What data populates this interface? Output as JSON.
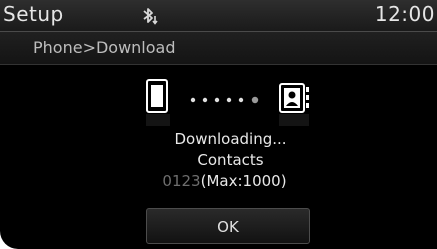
{
  "header": {
    "title": "Setup",
    "bluetooth_icon": "bluetooth-download-icon",
    "time": "12:00"
  },
  "breadcrumb": {
    "text": "Phone>Download"
  },
  "transfer": {
    "source_icon": "phone-icon",
    "target_icon": "contacts-book-icon",
    "progress_dots_total": 6,
    "progress_dots_active": 5
  },
  "dialog": {
    "status": "Downloading...",
    "item": "Contacts",
    "current_count": "0123",
    "max_label": "(Max:1000)",
    "ok_label": "OK"
  },
  "colors": {
    "background": "#000000",
    "text": "#e8e8e8",
    "count_dim": "#6e6e6e"
  }
}
